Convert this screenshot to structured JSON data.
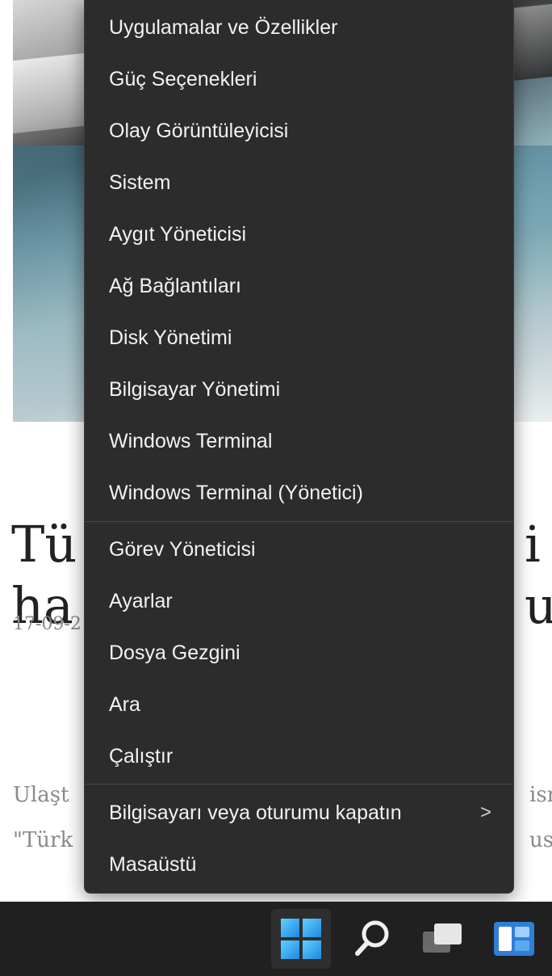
{
  "article": {
    "title_line1_left": "Tü",
    "title_line1_right": "i",
    "title_line2_left": "ha",
    "title_line2_right": "u",
    "date": "17-09-2",
    "body_line1_left": "Ulaşt",
    "body_line1_right": "ism",
    "body_line2_left": "\"Türk",
    "body_line2_right": "usu"
  },
  "menu": {
    "group1": [
      "Uygulamalar ve Özellikler",
      "Güç Seçenekleri",
      "Olay Görüntüleyicisi",
      "Sistem",
      "Aygıt Yöneticisi",
      "Ağ Bağlantıları",
      "Disk Yönetimi",
      "Bilgisayar Yönetimi",
      "Windows Terminal",
      "Windows Terminal (Yönetici)"
    ],
    "group2": [
      "Görev Yöneticisi",
      "Ayarlar",
      "Dosya Gezgini",
      "Ara",
      "Çalıştır"
    ],
    "shutdown": "Bilgisayarı veya oturumu kapatın",
    "shutdown_chevron": ">",
    "desktop": "Masaüstü"
  },
  "taskbar": {
    "icons": [
      "windows-start-icon",
      "search-icon",
      "task-view-icon",
      "widgets-icon"
    ],
    "accent": "#3aa7f0"
  }
}
